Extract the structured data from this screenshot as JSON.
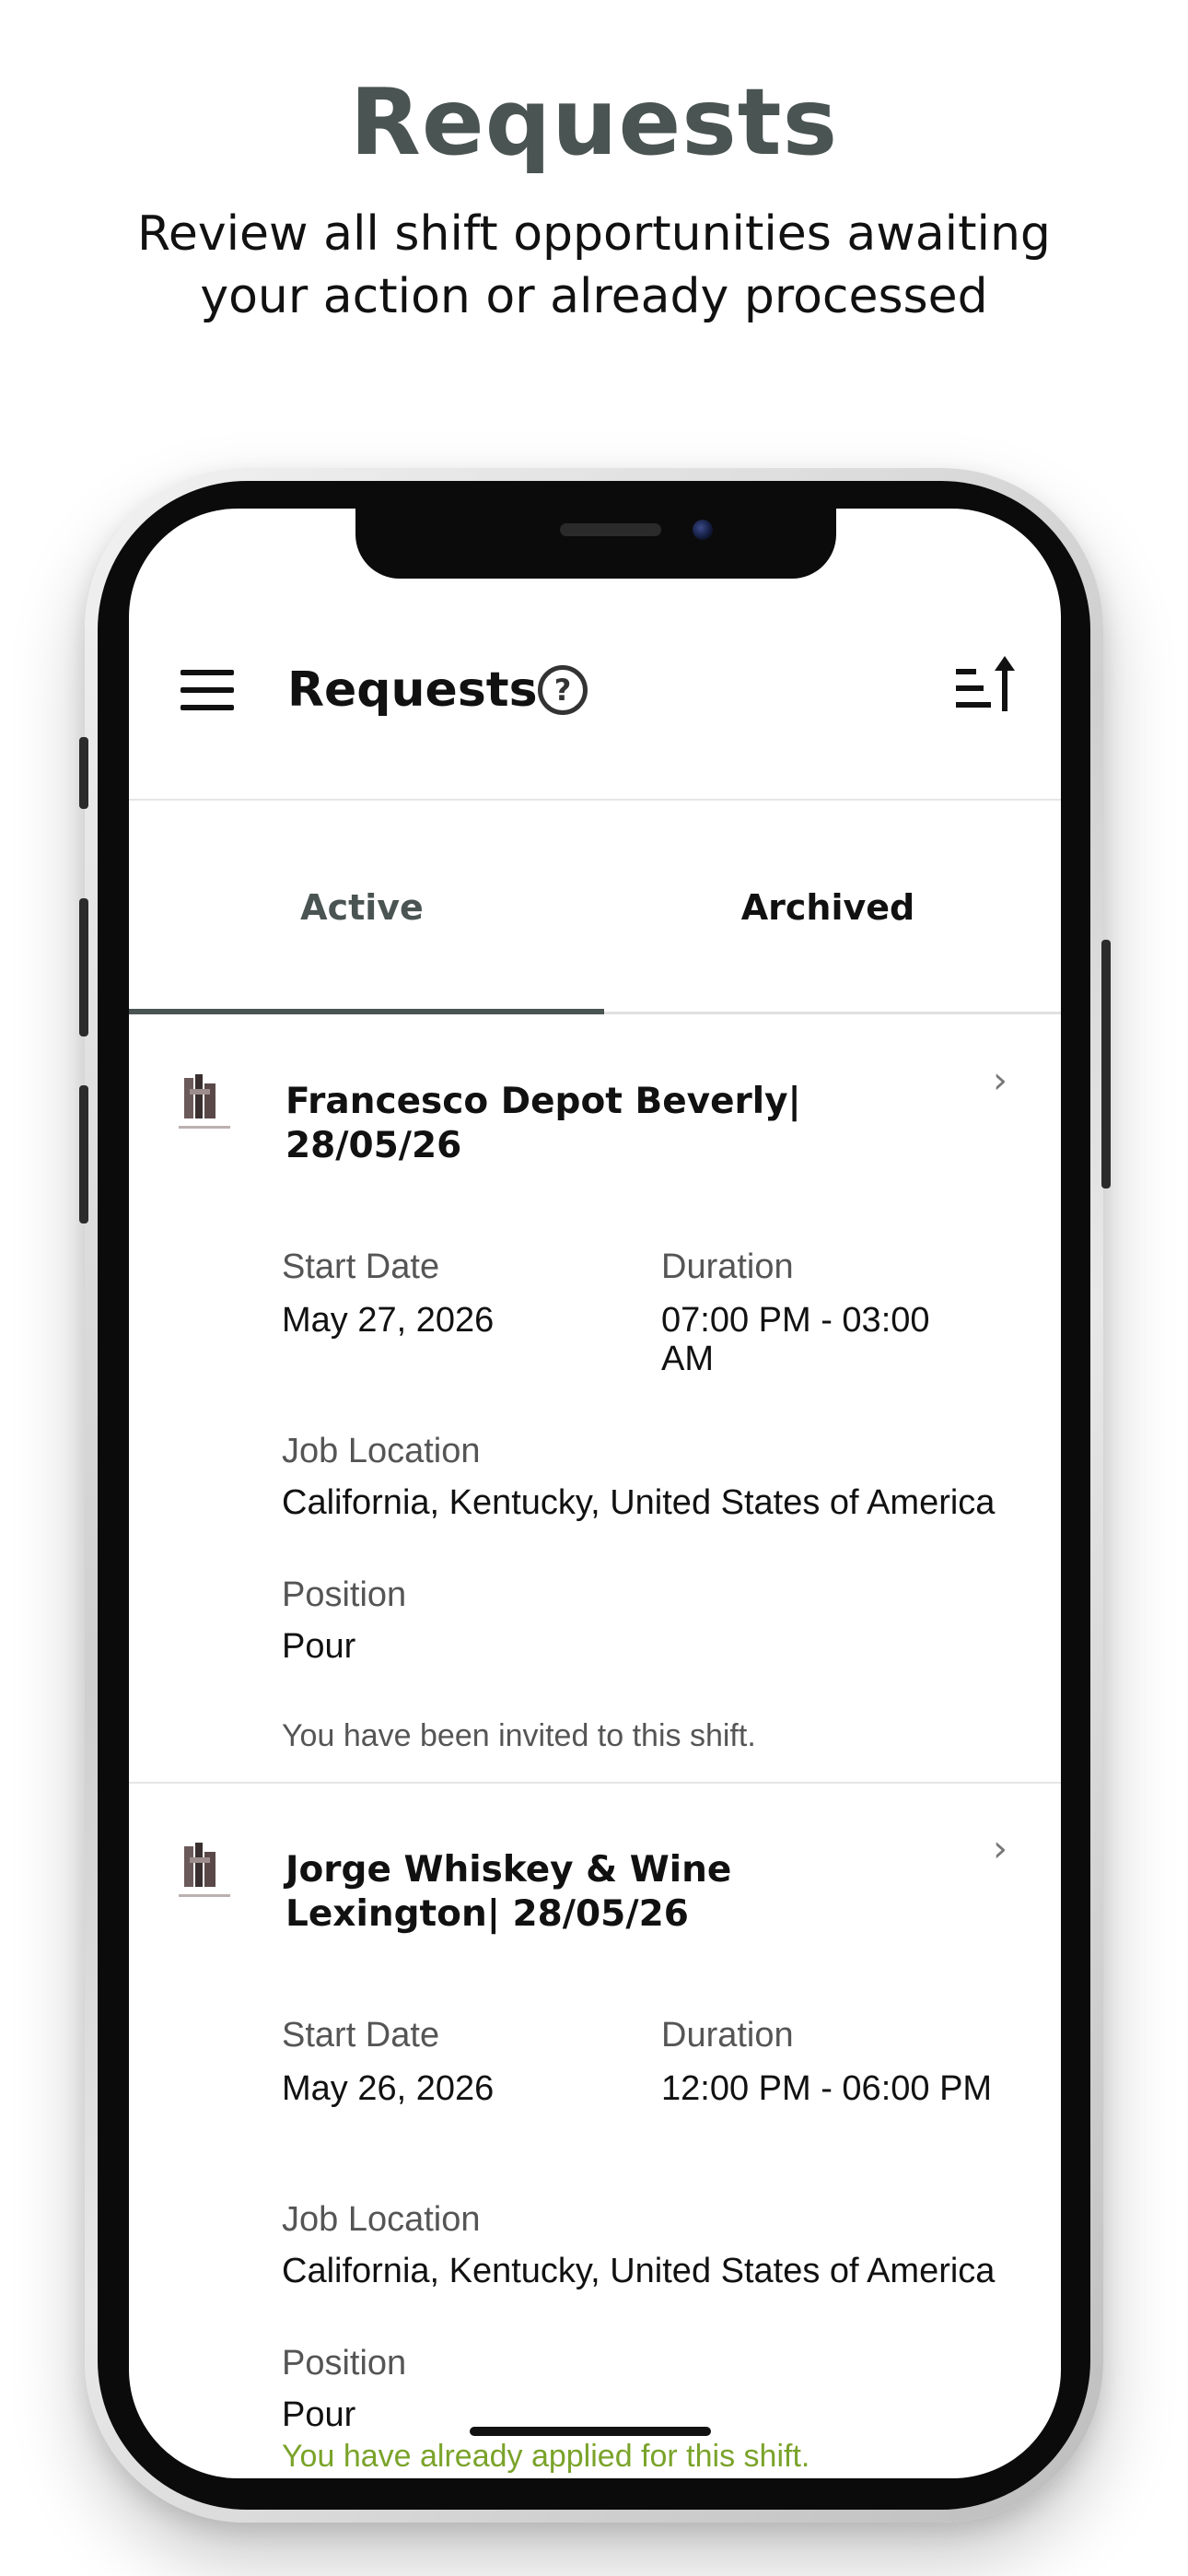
{
  "hero": {
    "title": "Requests",
    "subtitle": "Review all shift opportunities awaiting your action or already processed"
  },
  "app_bar": {
    "title": "Requests",
    "help_glyph": "?",
    "icons": [
      "menu-icon",
      "help-icon",
      "sort-ascending-icon"
    ]
  },
  "tabs": [
    {
      "label": "Active",
      "selected": true
    },
    {
      "label": "Archived",
      "selected": false
    }
  ],
  "labels": {
    "start_date": "Start Date",
    "duration": "Duration",
    "job_location": "Job Location",
    "position": "Position"
  },
  "requests": [
    {
      "title": "Francesco Depot Beverly| 28/05/26",
      "start_date": "May 27, 2026",
      "duration": "07:00 PM - 03:00 AM",
      "job_location": "California, Kentucky, United States of America",
      "position": "Pour",
      "status": "You have been invited to this shift.",
      "status_color": "#555555"
    },
    {
      "title": "Jorge Whiskey & Wine Lexington| 28/05/26",
      "start_date": "May 26, 2026",
      "duration": "12:00 PM - 06:00 PM",
      "job_location": "California, Kentucky, United States of America",
      "position": "Pour",
      "status": "You have already applied for this shift.",
      "status_color": "#7aa32a"
    }
  ],
  "colors": {
    "accent": "#4a5452",
    "applied_status": "#7aa32a"
  }
}
